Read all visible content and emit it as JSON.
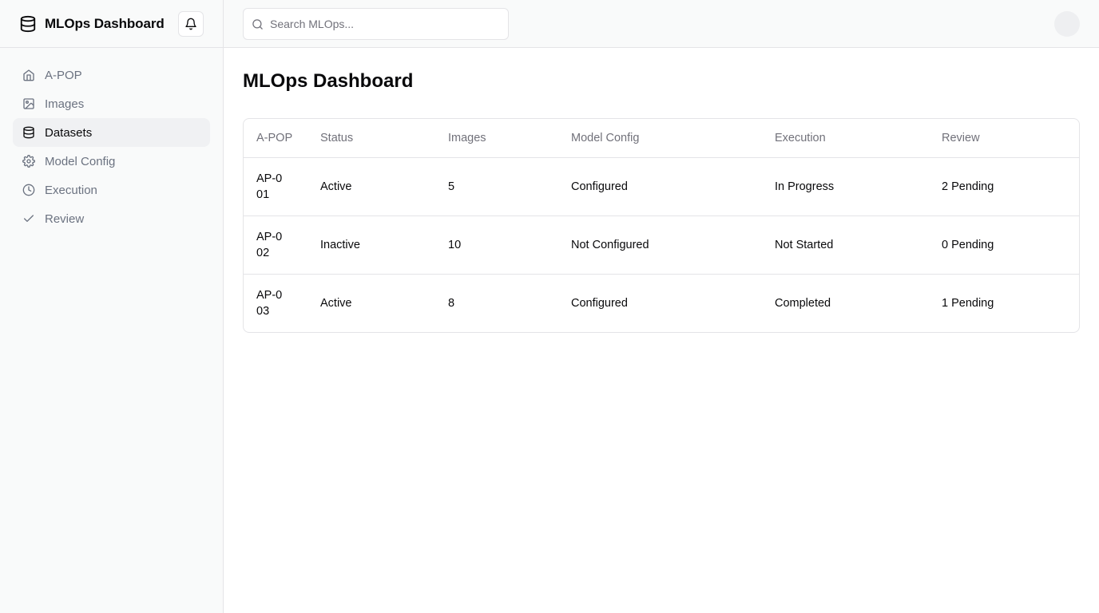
{
  "app": {
    "title": "MLOps Dashboard"
  },
  "icons": {
    "brand": "database-icon",
    "notifications": "bell-icon",
    "search": "search-icon"
  },
  "sidebar": {
    "items": [
      {
        "label": "A-POP",
        "icon": "home-icon",
        "active": false
      },
      {
        "label": "Images",
        "icon": "image-icon",
        "active": false
      },
      {
        "label": "Datasets",
        "icon": "database-icon",
        "active": true
      },
      {
        "label": "Model Config",
        "icon": "gear-icon",
        "active": false
      },
      {
        "label": "Execution",
        "icon": "clock-icon",
        "active": false
      },
      {
        "label": "Review",
        "icon": "check-icon",
        "active": false
      }
    ]
  },
  "search": {
    "placeholder": "Search MLOps...",
    "value": ""
  },
  "main": {
    "title": "MLOps Dashboard",
    "table": {
      "columns": [
        "A-POP",
        "Status",
        "Images",
        "Model Config",
        "Execution",
        "Review"
      ],
      "rows": [
        [
          "AP-001",
          "Active",
          "5",
          "Configured",
          "In Progress",
          "2 Pending"
        ],
        [
          "AP-002",
          "Inactive",
          "10",
          "Not Configured",
          "Not Started",
          "0 Pending"
        ],
        [
          "AP-003",
          "Active",
          "8",
          "Configured",
          "Completed",
          "1 Pending"
        ]
      ]
    }
  },
  "colors": {
    "sidebar_bg": "#f9fafa",
    "active_item_bg": "#f0f1f3",
    "border": "#e4e4e7",
    "muted_text": "#71717a"
  }
}
